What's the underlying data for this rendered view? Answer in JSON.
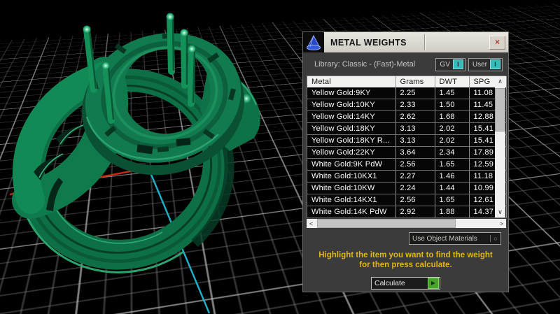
{
  "panel": {
    "title": "METAL WEIGHTS",
    "close_glyph": "×",
    "library_label": "Library: Classic - (Fast)-Metal",
    "gv_button": {
      "label": "GV",
      "indicator": "I"
    },
    "user_button": {
      "label": "User",
      "indicator": "I"
    },
    "use_materials_label": "Use Object Materials",
    "dropdown_circle_glyph": "○",
    "instruction_line1": "Highlight the item you want to find the weight",
    "instruction_line2": "for then press calculate.",
    "calculate_label": "Calculate",
    "calculate_glyph": "▶"
  },
  "table": {
    "columns": [
      "Metal",
      "Grams",
      "DWT",
      "SPG"
    ],
    "rows": [
      [
        "Yellow Gold:9KY",
        "2.25",
        "1.45",
        "11.08"
      ],
      [
        "Yellow Gold:10KY",
        "2.33",
        "1.50",
        "11.45"
      ],
      [
        "Yellow Gold:14KY",
        "2.62",
        "1.68",
        "12.88"
      ],
      [
        "Yellow Gold:18KY",
        "3.13",
        "2.02",
        "15.41"
      ],
      [
        "Yellow Gold:18KY R...",
        "3.13",
        "2.02",
        "15.41"
      ],
      [
        "Yellow Gold:22KY",
        "3.64",
        "2.34",
        "17.89"
      ],
      [
        "White Gold:9K PdW",
        "2.56",
        "1.65",
        "12.59"
      ],
      [
        "White Gold:10KX1",
        "2.27",
        "1.46",
        "11.18"
      ],
      [
        "White Gold:10KW",
        "2.24",
        "1.44",
        "10.99"
      ],
      [
        "White Gold:14KX1",
        "2.56",
        "1.65",
        "12.61"
      ],
      [
        "White Gold:14K PdW",
        "2.92",
        "1.88",
        "14.37"
      ]
    ]
  },
  "scrollbars": {
    "up_glyph": "∧",
    "down_glyph": "∨",
    "left_glyph": "<",
    "right_glyph": ">"
  },
  "colors": {
    "accent_teal": "#35bcb8",
    "instruction_yellow": "#dfb712",
    "calculate_green": "#47a32b",
    "axis_red": "#cf2b12",
    "axis_cyan": "#1fb2c8",
    "ring_green": "#117a4e",
    "panel_gray": "#3b3b3b"
  }
}
